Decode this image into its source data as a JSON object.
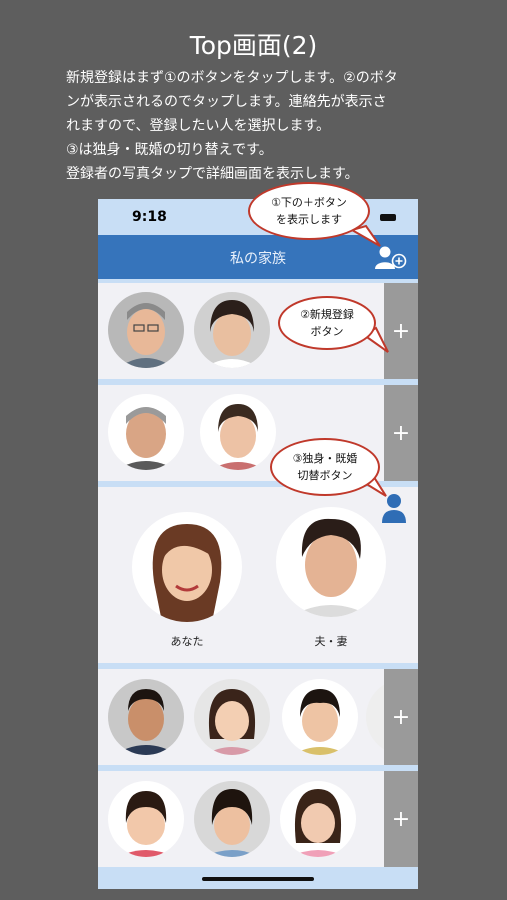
{
  "header": {
    "title": "Top画面(2)",
    "lines": [
      "新規登録はまず①のボタンをタップします。②のボタ",
      "ンが表示されるのでタップします。連絡先が表示さ",
      "れますので、登録したい人を選択します。",
      "③は独身・既婚の切り替えです。",
      "登録者の写真タップで詳細画面を表示します。"
    ]
  },
  "phone": {
    "time": "9:18",
    "nav_title": "私の家族",
    "plus": "+",
    "me_label": "あなた",
    "spouse_label": "夫・妻"
  },
  "callouts": {
    "c1": [
      "①下の＋ボタン",
      "を表示します"
    ],
    "c2": [
      "②新規登録",
      "ボタン"
    ],
    "c3": [
      "③独身・既婚",
      "切替ボタン"
    ]
  },
  "colors": {
    "navbar": "#3674bb",
    "accent_icon": "#2f6db5",
    "callout_border": "#c0392b",
    "plus_column": "#9a9a9a"
  }
}
